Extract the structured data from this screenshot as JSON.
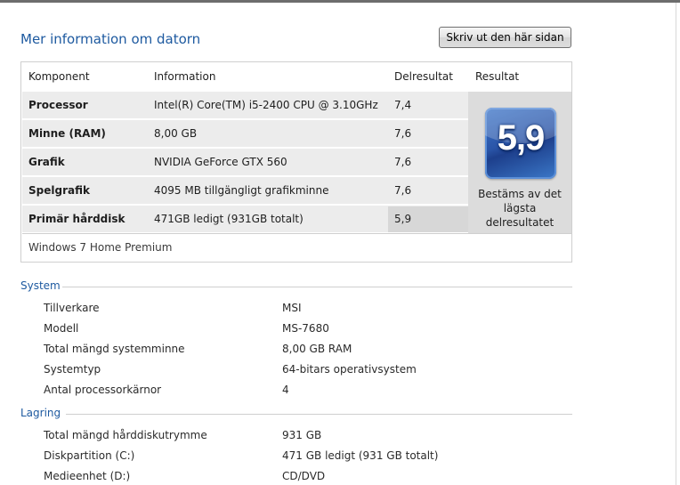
{
  "page_title": "Mer information om datorn",
  "print_button": "Skriv ut den här sidan",
  "wei": {
    "headers": {
      "component": "Komponent",
      "information": "Information",
      "subscore": "Delresultat",
      "result": "Resultat"
    },
    "rows": [
      {
        "component": "Processor",
        "information": "Intel(R) Core(TM) i5-2400 CPU @ 3.10GHz",
        "subscore": "7,4"
      },
      {
        "component": "Minne (RAM)",
        "information": "8,00 GB",
        "subscore": "7,6"
      },
      {
        "component": "Grafik",
        "information": "NVIDIA GeForce GTX 560",
        "subscore": "7,6"
      },
      {
        "component": "Spelgrafik",
        "information": "4095 MB tillgängligt grafikminne",
        "subscore": "7,6"
      },
      {
        "component": "Primär hårddisk",
        "information": "471GB ledigt (931GB totalt)",
        "subscore": "5,9"
      }
    ],
    "base_score": "5,9",
    "caption": "Bestäms av det lägsta delresultatet",
    "edition": "Windows 7 Home Premium"
  },
  "system": {
    "title": "System",
    "items": [
      {
        "label": "Tillverkare",
        "value": "MSI"
      },
      {
        "label": "Modell",
        "value": "MS-7680"
      },
      {
        "label": "Total mängd systemminne",
        "value": "8,00 GB RAM"
      },
      {
        "label": "Systemtyp",
        "value": "64-bitars operativsystem"
      },
      {
        "label": "Antal processorkärnor",
        "value": "4"
      }
    ]
  },
  "storage": {
    "title": "Lagring",
    "items": [
      {
        "label": "Total mängd hårddiskutrymme",
        "value": "931 GB"
      },
      {
        "label": "Diskpartition (C:)",
        "value": "471 GB ledigt (931 GB totalt)"
      },
      {
        "label": "Medieenhet (D:)",
        "value": "CD/DVD"
      }
    ]
  },
  "colors": {
    "heading": "#1e5aa0",
    "badge": "#2a55a8",
    "row_bg": "#ececec"
  }
}
